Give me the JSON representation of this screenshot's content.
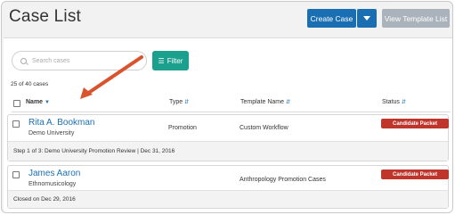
{
  "header": {
    "title": "Case List",
    "create_case_label": "Create Case",
    "view_template_label": "View Template List"
  },
  "search": {
    "placeholder": "Search cases"
  },
  "filter_label": "Filter",
  "case_count": "25 of 40 cases",
  "columns": {
    "name": "Name",
    "type": "Type",
    "template": "Template Name",
    "status": "Status"
  },
  "cases": [
    {
      "name": "Rita A. Bookman",
      "department": "Demo University",
      "type": "Promotion",
      "template": "Custom Workflow",
      "status": "Candidate Packet",
      "footer": "Step 1 of 3: Demo University Promotion Review  |  Dec 31, 2016"
    },
    {
      "name": "James Aaron",
      "department": "Ethnomusicology",
      "type": "",
      "template": "Anthropology Promotion Cases",
      "status": "Candidate Packet",
      "footer": "Closed on Dec 29, 2016"
    }
  ],
  "colors": {
    "primary": "#1a6fb3",
    "filter": "#1aa08c",
    "status": "#c0352b",
    "arrow": "#d9532c",
    "disabled": "#aab2bb"
  }
}
